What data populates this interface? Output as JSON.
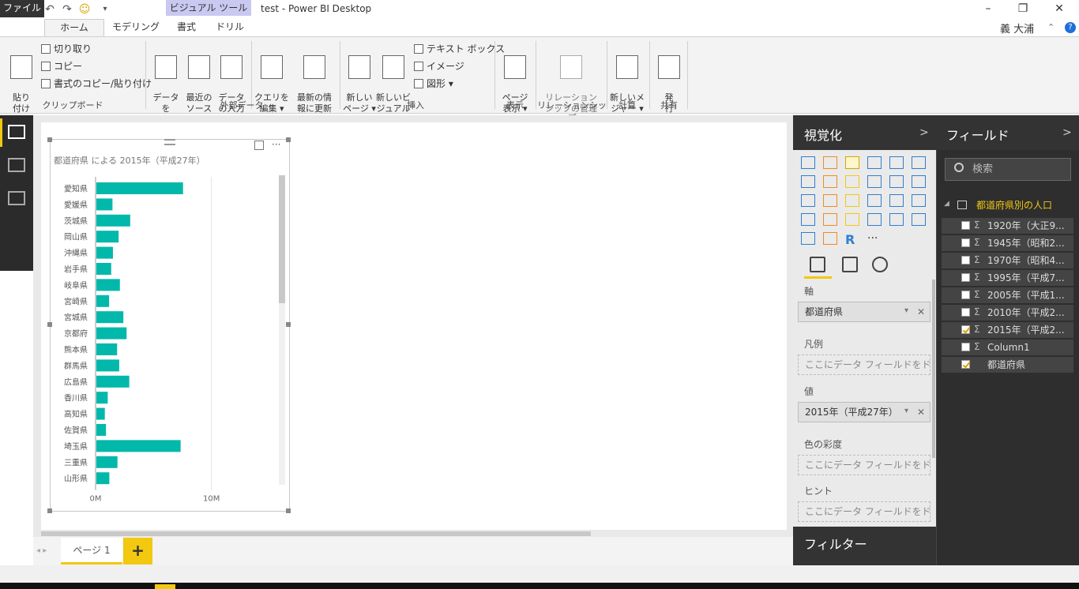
{
  "window": {
    "title": "test - Power BI Desktop",
    "contextual_tab_header": "ビジュアル ツール",
    "user": "義 大浦",
    "minimize": "–",
    "maximize": "❐",
    "close": "✕",
    "help": "?"
  },
  "tabs": {
    "file": "ファイル",
    "home": "ホーム",
    "modeling": "モデリング",
    "format": "書式",
    "drill": "ドリル"
  },
  "ribbon": {
    "paste": "貼り\n付け",
    "cut": "切り取り",
    "copy": "コピー",
    "format_painter": "書式のコピー/貼り付け",
    "clipboard_group": "クリップボード",
    "get_data": "データを\n取得 ▾",
    "recent_sources": "最近の\nソース ▾",
    "enter_data": "データ\nの入力",
    "edit_queries": "クエリを\n編集 ▾",
    "refresh": "最新の情\n報に更新",
    "external_group": "外部データ",
    "new_page": "新しい\nページ ▾",
    "new_visual": "新しいビ\nジュアル",
    "text_box": "テキスト ボックス",
    "image": "イメージ",
    "shapes": "図形 ▾",
    "insert_group": "挿入",
    "page_view": "ページ\n表示 ▾",
    "view_group": "表示",
    "manage_relationships": "リレーション\nシップの管理",
    "relationships_group": "リレーションシップ",
    "new_measure": "新しいメ\nジャー ▾",
    "calc_group": "計算",
    "publish": "発\n行",
    "share_group": "共有"
  },
  "visual": {
    "title": "都道府県 による 2015年（平成27年）",
    "more": "···"
  },
  "chart_data": {
    "type": "bar",
    "orientation": "horizontal",
    "categories": [
      "愛知県",
      "愛媛県",
      "茨城県",
      "岡山県",
      "沖縄県",
      "岩手県",
      "岐阜県",
      "宮崎県",
      "宮城県",
      "京都府",
      "熊本県",
      "群馬県",
      "広島県",
      "香川県",
      "高知県",
      "佐賀県",
      "埼玉県",
      "三重県",
      "山形県"
    ],
    "values": [
      7.48,
      1.39,
      2.92,
      1.92,
      1.43,
      1.28,
      2.03,
      1.1,
      2.33,
      2.61,
      1.79,
      1.97,
      2.84,
      0.98,
      0.73,
      0.83,
      7.27,
      1.82,
      1.12
    ],
    "unit": "M",
    "xlim": [
      0,
      15
    ],
    "xticks": [
      "0M",
      "10M"
    ],
    "xtick_values": [
      0,
      10
    ],
    "bar_color": "#01b8aa",
    "grid": true
  },
  "page_tabs": {
    "page1": "ページ 1",
    "add": "+",
    "nav": "◂ ▸"
  },
  "viz_pane": {
    "title": "視覚化",
    "chevron": ">",
    "axis_label": "軸",
    "axis_field": "都道府県",
    "legend_label": "凡例",
    "legend_placeholder": "ここにデータ フィールドをドラッグし...",
    "value_label": "値",
    "value_field": "2015年（平成27年）",
    "saturation_label": "色の彩度",
    "saturation_placeholder": "ここにデータ フィールドをドラッグし...",
    "tooltip_label": "ヒント",
    "tooltip_placeholder": "ここにデータ フィールドをドラッグし...",
    "filters_title": "フィルター",
    "remove": "✕",
    "dropdown": "▾",
    "more_visuals": "···",
    "r_visual": "R"
  },
  "fields_pane": {
    "title": "フィールド",
    "chevron": ">",
    "search_placeholder": "検索",
    "table": "都道府県別の人口",
    "fields": [
      {
        "name": "1920年（大正9...",
        "sigma": "Σ",
        "checked": false
      },
      {
        "name": "1945年（昭和2...",
        "sigma": "Σ",
        "checked": false
      },
      {
        "name": "1970年（昭和4...",
        "sigma": "Σ",
        "checked": false
      },
      {
        "name": "1995年（平成7...",
        "sigma": "Σ",
        "checked": false
      },
      {
        "name": "2005年（平成1...",
        "sigma": "Σ",
        "checked": false
      },
      {
        "name": "2010年（平成2...",
        "sigma": "Σ",
        "checked": false
      },
      {
        "name": "2015年（平成2...",
        "sigma": "Σ",
        "checked": true
      },
      {
        "name": "Column1",
        "sigma": "Σ",
        "checked": false
      },
      {
        "name": "都道府県",
        "sigma": "",
        "checked": true
      }
    ]
  }
}
